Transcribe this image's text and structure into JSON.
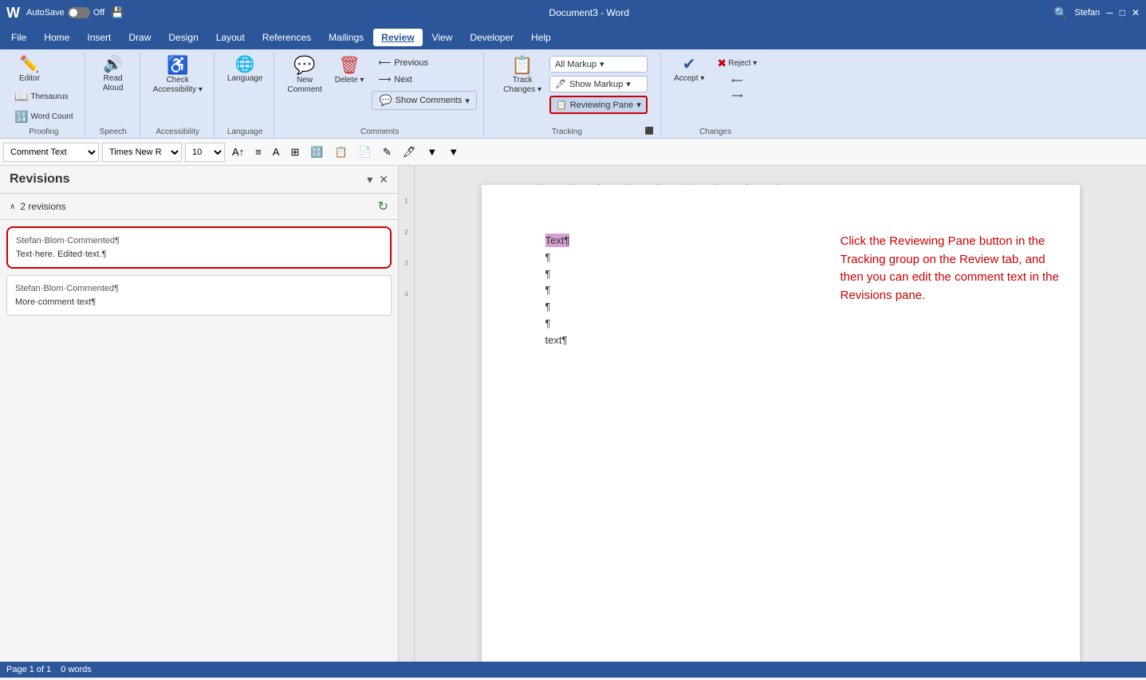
{
  "titlebar": {
    "logo": "W",
    "autosave_label": "AutoSave",
    "toggle_state": "Off",
    "doc_name": "Document3 - Word",
    "user": "Stefan"
  },
  "menu": {
    "items": [
      "File",
      "Home",
      "Insert",
      "Draw",
      "Design",
      "Layout",
      "References",
      "Mailings",
      "Review",
      "View",
      "Developer",
      "Help"
    ],
    "active": "Review"
  },
  "ribbon": {
    "groups": [
      {
        "name": "proofing",
        "label": "Proofing",
        "buttons": [
          {
            "id": "editor",
            "icon": "✏️",
            "label": "Editor"
          },
          {
            "id": "thesaurus",
            "icon": "📖",
            "label": "Thesaurus"
          },
          {
            "id": "wordcount",
            "icon": "123",
            "label": "Word Count"
          }
        ]
      },
      {
        "name": "speech",
        "label": "Speech",
        "buttons": [
          {
            "id": "readaloud",
            "icon": "🔊",
            "label": "Read\nAloud"
          }
        ]
      },
      {
        "name": "accessibility",
        "label": "Accessibility",
        "buttons": [
          {
            "id": "checkacc",
            "icon": "✔",
            "label": "Check\nAccessibility"
          }
        ]
      },
      {
        "name": "language",
        "label": "Language",
        "buttons": [
          {
            "id": "language",
            "icon": "🌐",
            "label": "Language"
          }
        ]
      },
      {
        "name": "comments",
        "label": "Comments",
        "buttons": [
          {
            "id": "newcomment",
            "icon": "💬",
            "label": "New\nComment"
          },
          {
            "id": "delete",
            "icon": "🗑",
            "label": "Delete"
          }
        ],
        "nav": [
          "Previous",
          "Next"
        ],
        "show_comments": "Show Comments"
      },
      {
        "name": "tracking",
        "label": "Tracking",
        "buttons": [
          {
            "id": "trackchanges",
            "icon": "📝",
            "label": "Track\nChanges"
          }
        ],
        "dropdowns": {
          "all_markup": "All Markup",
          "show_markup": "Show Markup",
          "reviewing_pane": "Reviewing Pane"
        }
      },
      {
        "name": "changes",
        "label": "Changes",
        "buttons": [
          {
            "id": "accept",
            "icon": "✔",
            "label": "Accept"
          },
          {
            "id": "reject",
            "icon": "✖",
            "label": "Reject"
          }
        ]
      }
    ]
  },
  "formatting_bar": {
    "style": "Comment Text",
    "font": "Times New R",
    "size": "10"
  },
  "revisions_pane": {
    "title": "Revisions",
    "count_label": "2 revisions",
    "items": [
      {
        "author": "Stefan·Blom·Commented¶",
        "text": "Text·here. Edited·text.¶",
        "highlighted": true
      },
      {
        "author": "Stefan·Blom·Commented¶",
        "text": "More·comment·text¶",
        "highlighted": false
      }
    ]
  },
  "document": {
    "highlighted_word": "Text¶",
    "pilcrows": [
      "¶",
      "¶",
      "¶",
      "¶",
      "¶"
    ],
    "bottom_text": "text¶"
  },
  "annotation": {
    "text": "Click the Reviewing Pane button in the Tracking group on the Review tab, and then you can edit the comment text in the Revisions pane."
  },
  "ruler": {
    "marks": [
      "1",
      "2",
      "3",
      "4",
      "5",
      "6",
      "7",
      "8",
      "9"
    ]
  },
  "statusbar": {
    "items": []
  }
}
